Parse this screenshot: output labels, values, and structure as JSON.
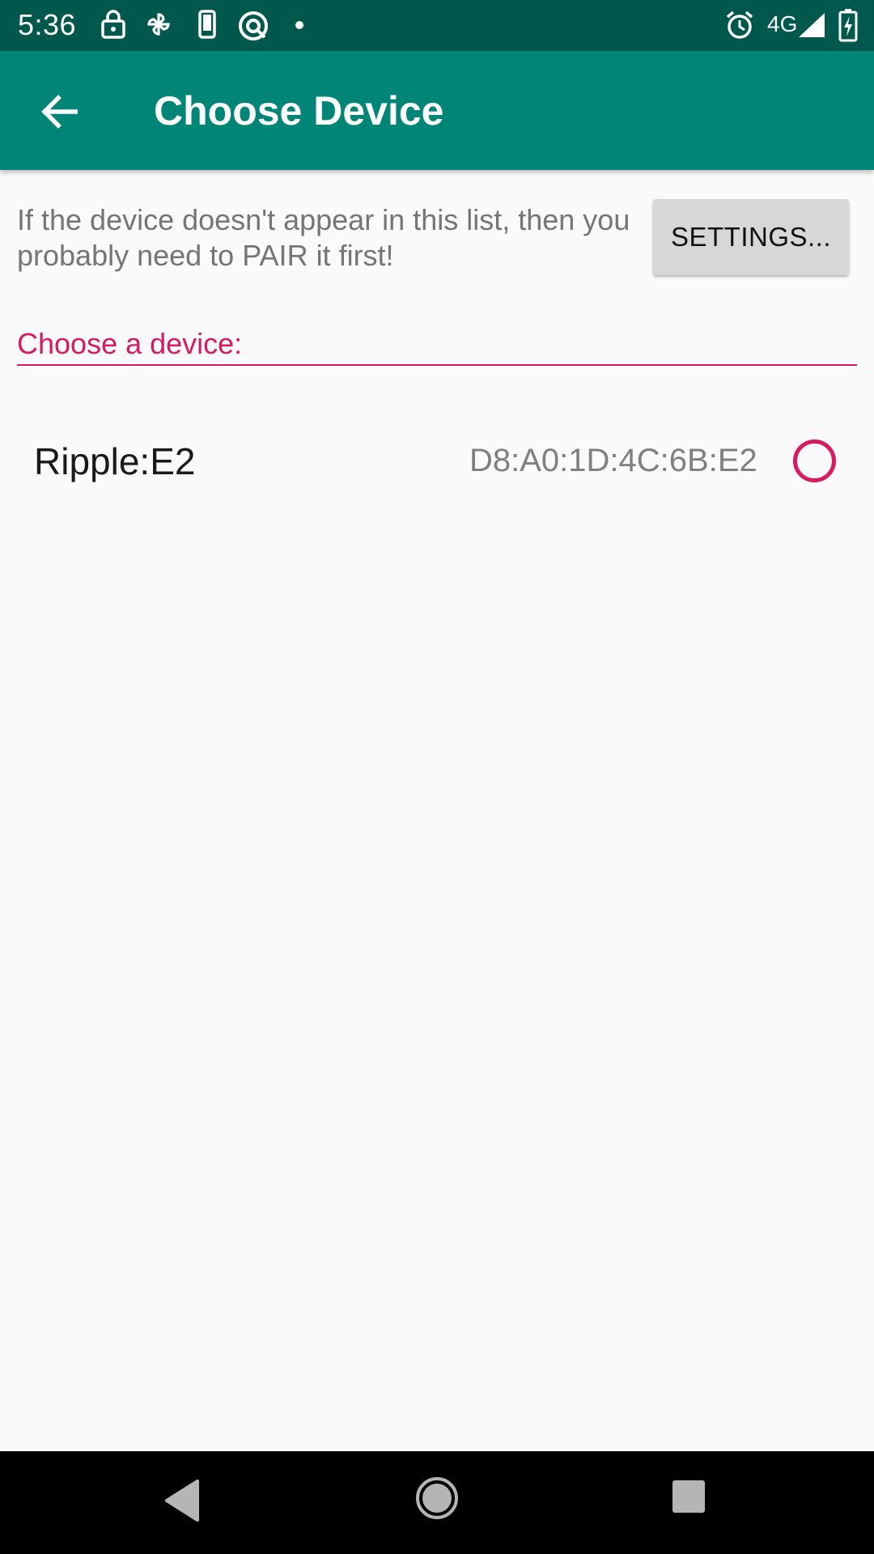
{
  "status_bar": {
    "time": "5:36",
    "network": "4G",
    "icons": [
      "lock-icon",
      "pinwheel-icon",
      "phone-icon",
      "no-entry-icon",
      "dot-icon",
      "alarm-icon",
      "signal-icon",
      "battery-charging-icon"
    ]
  },
  "app_bar": {
    "title": "Choose Device",
    "back_icon": "arrow-back-icon"
  },
  "hint": {
    "text": "If the device doesn't appear in this list, then you probably need to PAIR it first!"
  },
  "settings_button": {
    "label": "SETTINGS..."
  },
  "device_section": {
    "label": "Choose a device:"
  },
  "devices": [
    {
      "name": "Ripple:E2",
      "mac": "D8:A0:1D:4C:6B:E2",
      "selected": false
    }
  ],
  "colors": {
    "status_bar": "#00574b",
    "app_bar": "#008577",
    "accent": "#d81b60",
    "background": "#fafafa"
  },
  "nav_bar": {
    "icons": [
      "back-triangle-icon",
      "home-circle-icon",
      "recents-square-icon"
    ]
  }
}
